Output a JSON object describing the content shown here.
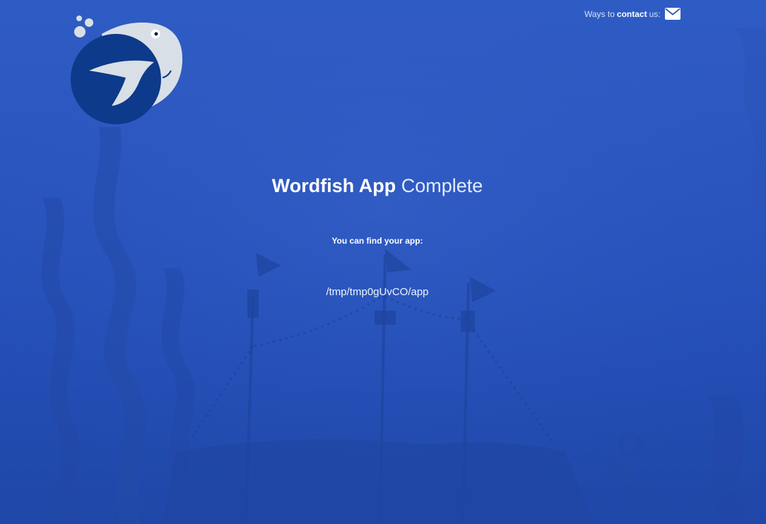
{
  "header": {
    "contact_prefix": "Ways to",
    "contact_strong": "contact",
    "contact_suffix": "us:",
    "contact_icon": "envelope-icon",
    "logo_icon": "wordfish-logo-icon"
  },
  "main": {
    "title_bold": "Wordfish App",
    "title_light": "Complete",
    "subtitle": "You can find your app:",
    "app_path": "/tmp/tmp0gUvCO/app"
  },
  "colors": {
    "background": "#2a55be",
    "logo_dark": "#0d3a8a",
    "logo_light": "#d9dfe6"
  }
}
